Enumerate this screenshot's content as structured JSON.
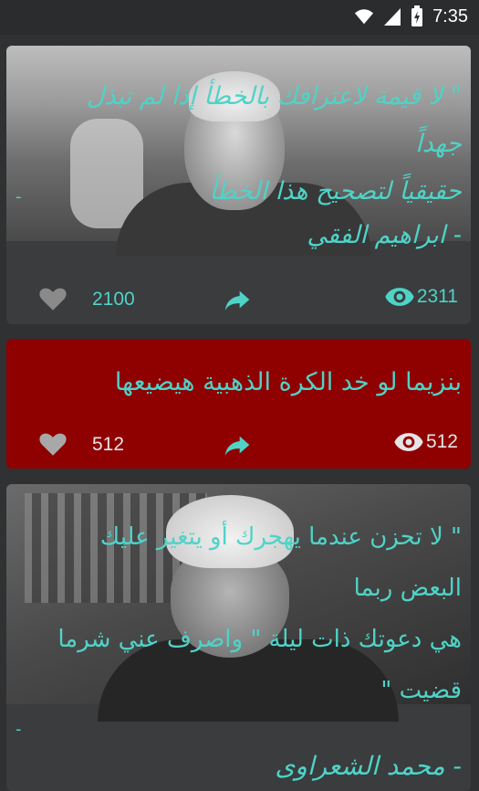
{
  "status_bar": {
    "time": "7:35"
  },
  "accent_color": "#4fd3c7",
  "posts": [
    {
      "quote_lines": [
        "\" لا قيمة لاعترافك بالخطأ إذا لم تبذل جهداً",
        "حقيقياً لتصحيح هذا الخطأ"
      ],
      "dash": "-",
      "author": "- ابراهيم الفقي",
      "likes": "2100",
      "views": "2311"
    },
    {
      "quote_lines": [
        "بنزيما لو خد الكرة الذهبية هيضيعها"
      ],
      "likes": "512",
      "views": "512",
      "background": "#8f0000"
    },
    {
      "quote_lines": [
        "\" لا تحزن عندما يهجرك أو يتغير عليك",
        "البعض ربما",
        "هي دعوتك ذات ليلة \" واصرف عني شرما",
        "قضيت \""
      ],
      "dash": "-",
      "author": "- محمد الشعراوى"
    }
  ]
}
